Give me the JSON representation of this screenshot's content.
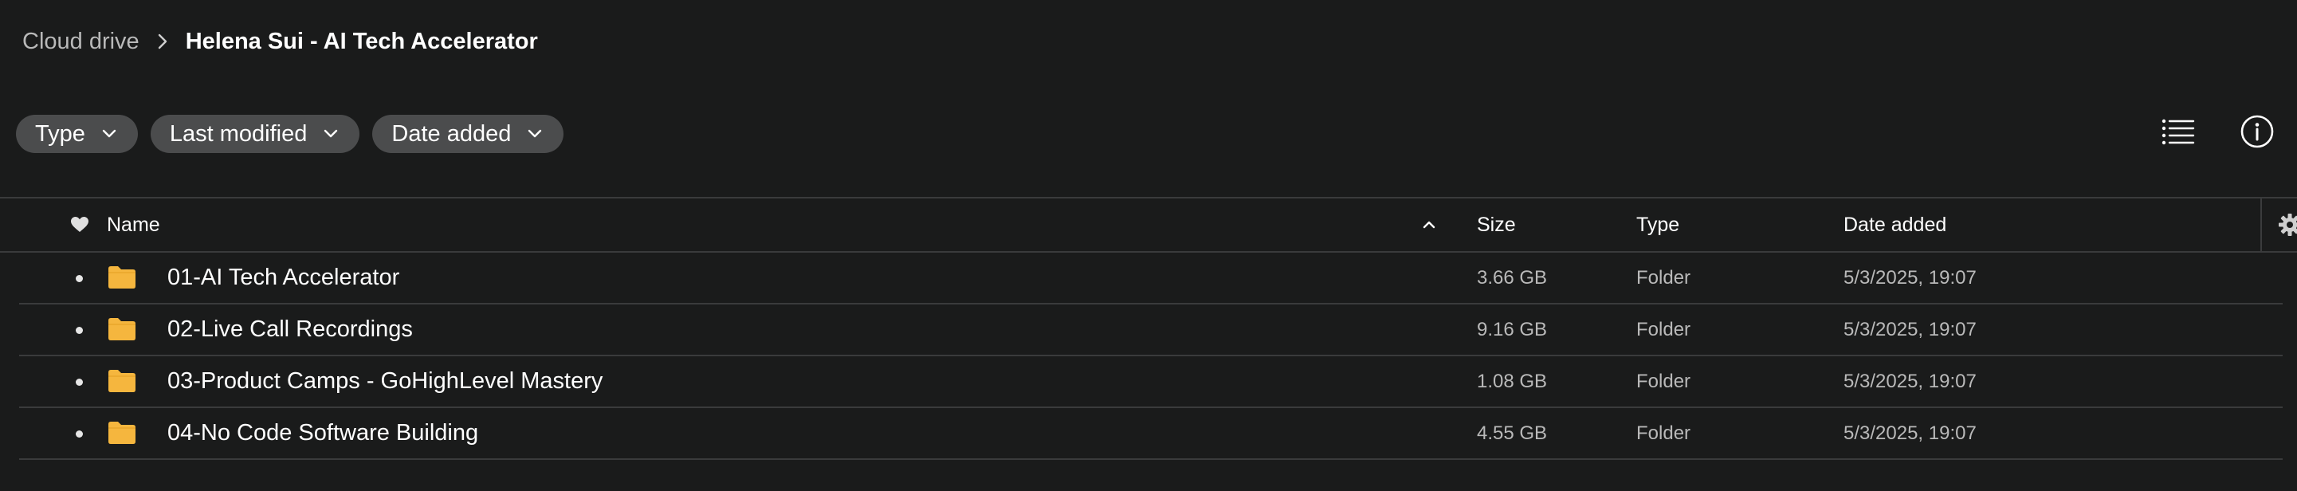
{
  "breadcrumb": {
    "root": "Cloud drive",
    "separator_icon": "chevron-right-icon",
    "current": "Helena Sui - AI Tech Accelerator"
  },
  "filters": [
    {
      "label": "Type",
      "icon": "chevron-down-icon"
    },
    {
      "label": "Last modified",
      "icon": "chevron-down-icon"
    },
    {
      "label": "Date added",
      "icon": "chevron-down-icon"
    }
  ],
  "toolbar": {
    "list_view_icon": "list-view-icon",
    "info_icon": "info-icon"
  },
  "table": {
    "columns": {
      "favorite_icon": "heart-icon",
      "name": "Name",
      "sort_icon": "chevron-up-icon",
      "size": "Size",
      "type": "Type",
      "date_added": "Date added",
      "settings_icon": "gear-icon"
    },
    "rows": [
      {
        "name": "01-AI Tech Accelerator",
        "size": "3.66 GB",
        "type": "Folder",
        "date_added": "5/3/2025, 19:07"
      },
      {
        "name": "02-Live Call Recordings",
        "size": "9.16 GB",
        "type": "Folder",
        "date_added": "5/3/2025, 19:07"
      },
      {
        "name": "03-Product Camps - GoHighLevel Mastery",
        "size": "1.08 GB",
        "type": "Folder",
        "date_added": "5/3/2025, 19:07"
      },
      {
        "name": "04-No Code Software Building",
        "size": "4.55 GB",
        "type": "Folder",
        "date_added": "5/3/2025, 19:07"
      }
    ]
  },
  "colors": {
    "background": "#1a1b1b",
    "chip": "#4b4c4d",
    "folder": "#f5b63e",
    "divider": "#3a3b3c",
    "muted_text": "#b9b9b9"
  }
}
